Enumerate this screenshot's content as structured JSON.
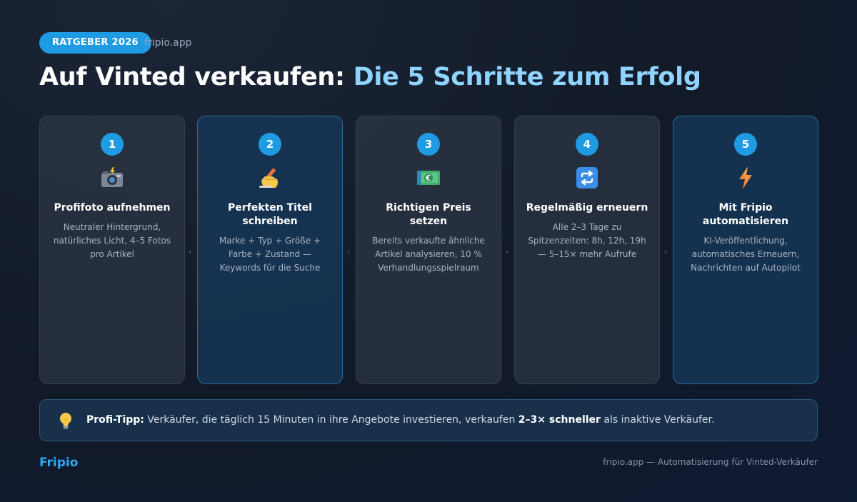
{
  "header": {
    "badge": "RATGEBER 2026",
    "site": "fripio.app",
    "title_main": "Auf Vinted verkaufen: ",
    "title_accent": "Die 5 Schritte zum Erfolg"
  },
  "steps": [
    {
      "number": "1",
      "icon": "camera-flash-icon",
      "title": "Profifoto aufnehmen",
      "desc": "Neutraler Hintergrund, natürliches Licht, 4–5 Fotos pro Artikel"
    },
    {
      "number": "2",
      "icon": "writing-hand-icon",
      "title": "Perfekten Titel schreiben",
      "desc": "Marke + Typ + Größe + Farbe + Zustand — Keywords für die Suche"
    },
    {
      "number": "3",
      "icon": "euro-banknote-icon",
      "title": "Richtigen Preis setzen",
      "desc": "Bereits verkaufte ähnliche Artikel analysieren, 10 % Verhandlungsspielraum"
    },
    {
      "number": "4",
      "icon": "repeat-icon",
      "title": "Regelmäßig erneuern",
      "desc": "Alle 2–3 Tage zu Spitzenzeiten: 8h, 12h, 19h — 5–15× mehr Aufrufe"
    },
    {
      "number": "5",
      "icon": "lightning-icon",
      "title": "Mit Fripio automatisieren",
      "desc": "KI-Veröffentlichung, automatisches Erneuern, Nachrichten auf Autopilot"
    }
  ],
  "arrows": [
    "›",
    "›",
    "›",
    "›"
  ],
  "tip": {
    "label": "Profi-Tipp:",
    "text_before": " Verkäufer, die täglich 15 Minuten in ihre Angebote investieren, verkaufen ",
    "highlight": "2–3× schneller",
    "text_after": " als inaktive Verkäufer."
  },
  "footer": {
    "brand": "Fripio",
    "text": "fripio.app — Automatisierung für Vinted-Verkäufer"
  },
  "colors": {
    "accent": "#1e9be3",
    "title_accent": "#8fd3ff",
    "brand": "#2aa8f2"
  }
}
